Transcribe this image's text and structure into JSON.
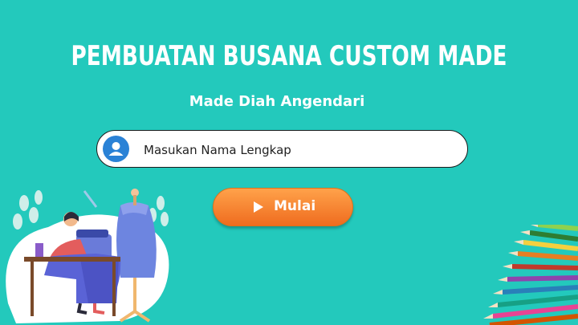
{
  "header": {
    "title": "PEMBUATAN BUSANA CUSTOM MADE",
    "subtitle": "Made Diah Angendari"
  },
  "name_input": {
    "placeholder": "Masukan Nama Lengkap",
    "value": "",
    "icon": "user-icon"
  },
  "start_button": {
    "label": "Mulai",
    "icon": "play-icon"
  },
  "colors": {
    "background": "#23c9bc",
    "button_orange": "#f58a34",
    "avatar_blue": "#2a82d6"
  },
  "illustrations": {
    "left": "tailor-sewing-illustration",
    "right": "colored-pencils-illustration"
  }
}
